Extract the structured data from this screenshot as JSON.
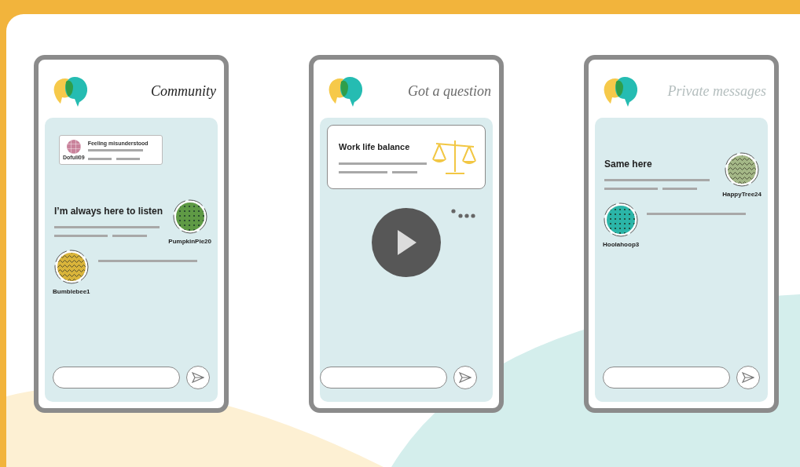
{
  "phones": [
    {
      "title": {
        "text": "Community",
        "color": "#1f1f1f"
      },
      "items": [
        {
          "kind": "mini_card",
          "title": "Feeling misunderstood",
          "user": "Dofuli09",
          "avatar": {
            "kind": "grid",
            "color": "#c9829b"
          }
        },
        {
          "kind": "reply",
          "text": "I’m always here to listen",
          "user": "PumpkinPie20",
          "avatar": {
            "kind": "dots",
            "color": "#5f9a45"
          }
        },
        {
          "kind": "incoming",
          "user": "Bumblebee1",
          "avatar": {
            "kind": "waves",
            "color": "#d9b43a"
          }
        }
      ]
    },
    {
      "title": {
        "text": "Got a question",
        "color": "#6b6b6b"
      },
      "items": [
        {
          "kind": "topic",
          "title": "Work life balance"
        },
        {
          "kind": "video"
        }
      ]
    },
    {
      "title": {
        "text": "Private messages",
        "color": "#b4bebe"
      },
      "items": [
        {
          "kind": "reply",
          "text": "Same here",
          "user": "HappyTree24",
          "avatar": {
            "kind": "waves",
            "color": "#a4b887"
          }
        },
        {
          "kind": "incoming",
          "user": "Hoolahoop3",
          "avatar": {
            "kind": "dots",
            "color": "#2bb5a8"
          }
        }
      ]
    }
  ]
}
